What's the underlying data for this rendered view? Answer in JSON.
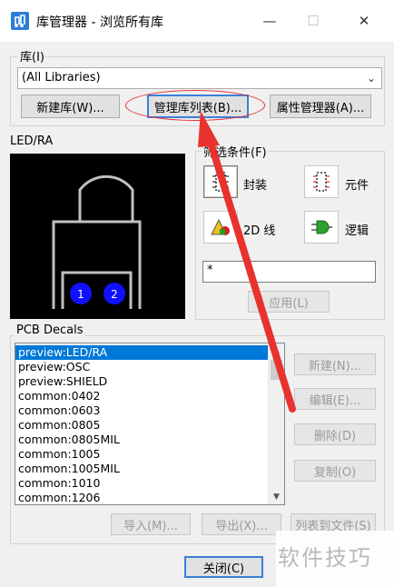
{
  "window": {
    "title": "库管理器 - 浏览所有库",
    "minimize_glyph": "—",
    "maximize_glyph": "☐",
    "close_glyph": "✕"
  },
  "library": {
    "label": "库(I)",
    "selected": "(All Libraries)",
    "new_library_button": "新建库(W)...",
    "manage_list_button": "管理库列表(B)...",
    "attribute_manager_button": "属性管理器(A)..."
  },
  "preview": {
    "label": "LED/RA",
    "pin_labels": [
      "1",
      "2"
    ]
  },
  "filter": {
    "label": "筛选条件(F)",
    "decal_label": "封装",
    "part_label": "元件",
    "line2d_label": "2D 线",
    "logic_label": "逻辑",
    "pattern_value": "*",
    "apply_button": "应用(L)"
  },
  "decals": {
    "label": "PCB Decals",
    "items": [
      "preview:LED/RA",
      "preview:OSC",
      "preview:SHIELD",
      "common:0402",
      "common:0603",
      "common:0805",
      "common:0805MIL",
      "common:1005",
      "common:1005MIL",
      "common:1010",
      "common:1206"
    ],
    "selected_index": 0,
    "new_button": "新建(N)...",
    "edit_button": "编辑(E)...",
    "delete_button": "删除(D)",
    "copy_button": "复制(O)",
    "import_button": "导入(M)...",
    "export_button": "导出(X)...",
    "list_to_file_button": "列表到文件(S)"
  },
  "close_button": "关闭(C)",
  "watermark": "软件技巧",
  "colors": {
    "annotation_red": "#e8322e",
    "selection_blue": "#0078d7",
    "pin_blue": "#1010ff"
  }
}
